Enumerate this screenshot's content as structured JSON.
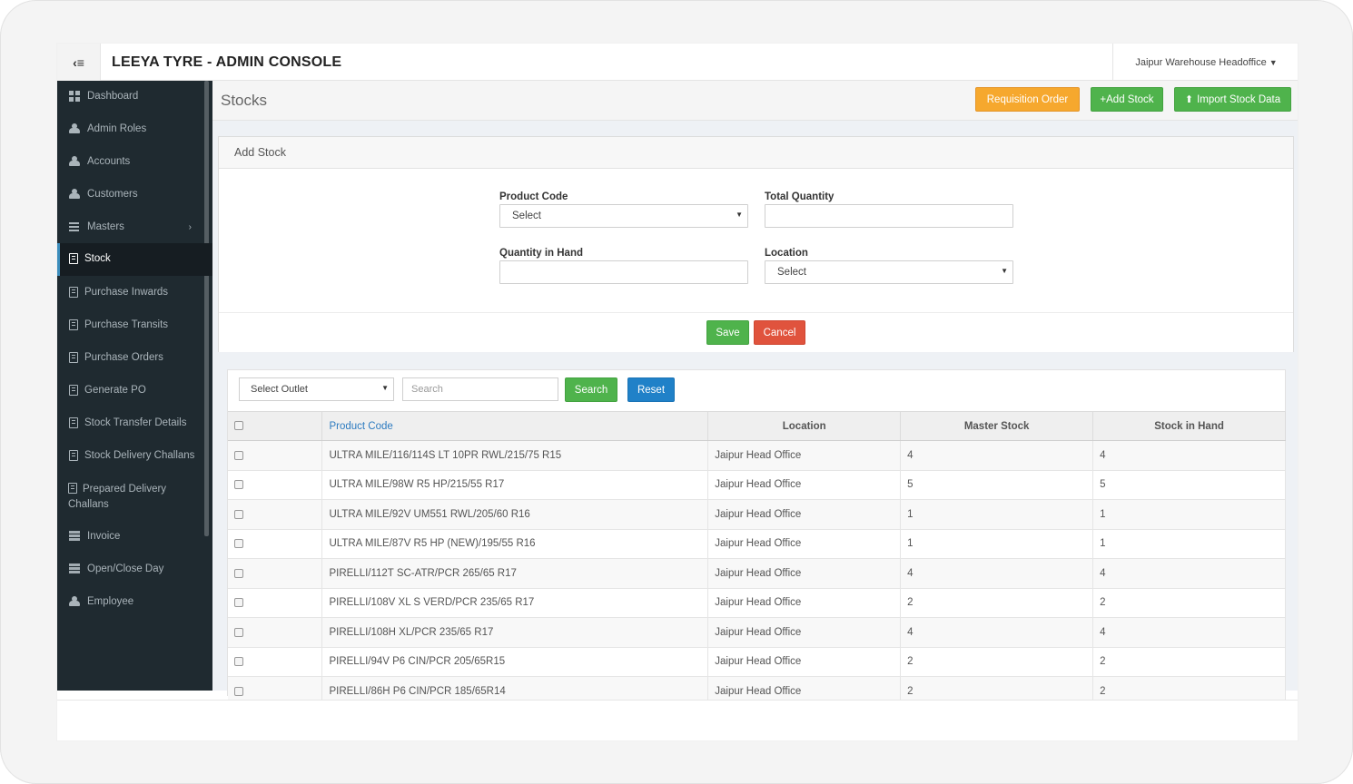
{
  "header": {
    "brand": "LEEYA TYRE - ADMIN CONSOLE",
    "toggle_icon": "sidebar-toggle-icon",
    "warehouse": "Jaipur Warehouse Headoffice"
  },
  "sidebar": {
    "items": [
      {
        "label": "Dashboard",
        "icon": "dashboard-icon"
      },
      {
        "label": "Admin Roles",
        "icon": "users-icon"
      },
      {
        "label": "Accounts",
        "icon": "users-icon"
      },
      {
        "label": "Customers",
        "icon": "users-icon"
      },
      {
        "label": "Masters",
        "icon": "bars-icon"
      },
      {
        "label": "Stock",
        "icon": "book-icon",
        "active": true
      },
      {
        "label": "Purchase Inwards",
        "icon": "book-icon"
      },
      {
        "label": "Purchase Transits",
        "icon": "book-icon"
      },
      {
        "label": "Purchase Orders",
        "icon": "book-icon"
      },
      {
        "label": "Generate PO",
        "icon": "book-icon"
      },
      {
        "label": "Stock Transfer Details",
        "icon": "book-icon"
      },
      {
        "label": "Stock Delivery Challans",
        "icon": "book-icon"
      },
      {
        "label": "Prepared Delivery Challans",
        "icon": "book-icon"
      },
      {
        "label": "Invoice",
        "icon": "list-icon"
      },
      {
        "label": "Open/Close Day",
        "icon": "list-icon"
      },
      {
        "label": "Employee",
        "icon": "users-icon"
      }
    ]
  },
  "page": {
    "title": "Stocks",
    "actions": {
      "requisition": "Requisition Order",
      "add_stock": "+Add Stock",
      "import_stock": "Import Stock Data"
    }
  },
  "form": {
    "heading": "Add Stock",
    "product_code_label": "Product Code",
    "product_code_value": "Select",
    "total_quantity_label": "Total Quantity",
    "total_quantity_value": "",
    "quantity_in_hand_label": "Quantity in Hand",
    "quantity_in_hand_value": "",
    "location_label": "Location",
    "location_value": "Select",
    "save": "Save",
    "cancel": "Cancel"
  },
  "filters": {
    "outlet_value": "Select Outlet",
    "search_placeholder": "Search",
    "search_button": "Search",
    "reset_button": "Reset"
  },
  "table": {
    "columns": [
      "Product Code",
      "Location",
      "Master Stock",
      "Stock in Hand"
    ],
    "rows": [
      {
        "product_code": "ULTRA MILE/116/114S LT 10PR RWL/215/75 R15",
        "location": "Jaipur Head Office",
        "master_stock": "4",
        "stock_in_hand": "4"
      },
      {
        "product_code": "ULTRA MILE/98W R5 HP/215/55 R17",
        "location": "Jaipur Head Office",
        "master_stock": "5",
        "stock_in_hand": "5"
      },
      {
        "product_code": "ULTRA MILE/92V UM551 RWL/205/60 R16",
        "location": "Jaipur Head Office",
        "master_stock": "1",
        "stock_in_hand": "1"
      },
      {
        "product_code": "ULTRA MILE/87V R5 HP (NEW)/195/55 R16",
        "location": "Jaipur Head Office",
        "master_stock": "1",
        "stock_in_hand": "1"
      },
      {
        "product_code": "PIRELLI/112T SC-ATR/PCR 265/65 R17",
        "location": "Jaipur Head Office",
        "master_stock": "4",
        "stock_in_hand": "4"
      },
      {
        "product_code": "PIRELLI/108V XL S VERD/PCR 235/65 R17",
        "location": "Jaipur Head Office",
        "master_stock": "2",
        "stock_in_hand": "2"
      },
      {
        "product_code": "PIRELLI/108H XL/PCR 235/65 R17",
        "location": "Jaipur Head Office",
        "master_stock": "4",
        "stock_in_hand": "4"
      },
      {
        "product_code": "PIRELLI/94V P6 CIN/PCR 205/65R15",
        "location": "Jaipur Head Office",
        "master_stock": "2",
        "stock_in_hand": "2"
      },
      {
        "product_code": "PIRELLI/86H P6 CIN/PCR 185/65R14",
        "location": "Jaipur Head Office",
        "master_stock": "2",
        "stock_in_hand": "2"
      }
    ]
  },
  "colors": {
    "sidebar_bg": "#1f2a30",
    "active_accent": "#3c8dbc",
    "orange": "#f6a82e",
    "green": "#4fb34c",
    "red": "#e0533d",
    "blue": "#2081c8"
  }
}
